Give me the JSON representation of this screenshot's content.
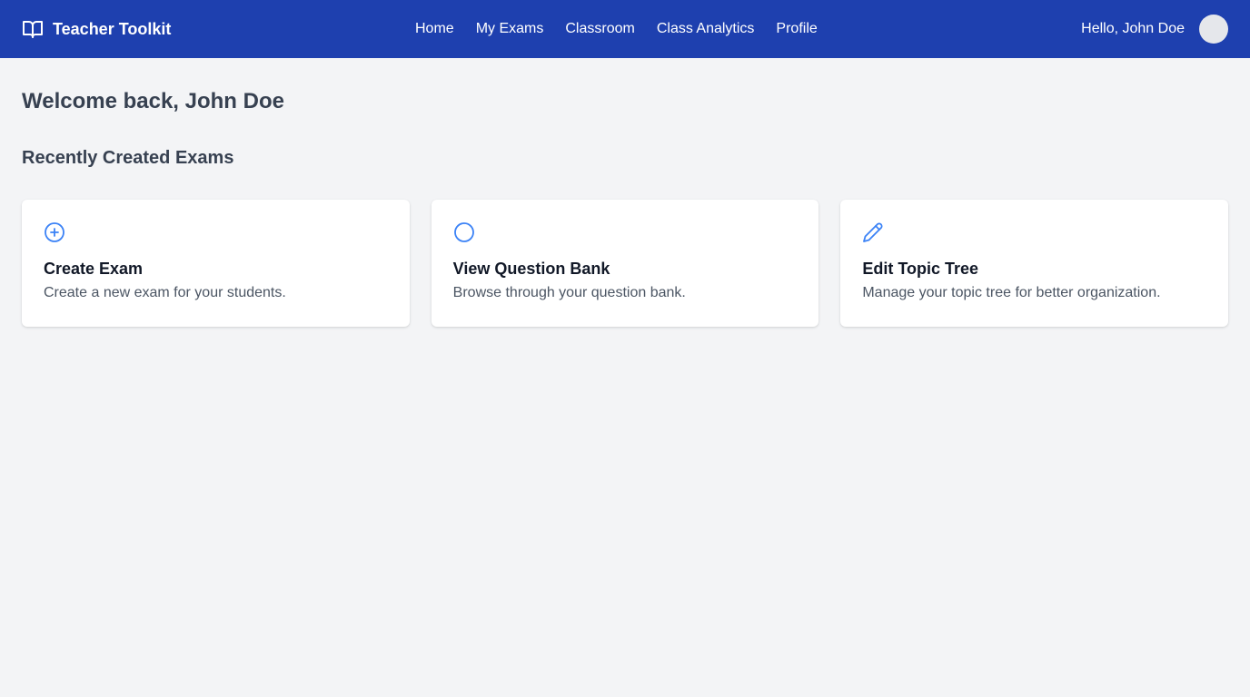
{
  "header": {
    "brand": "Teacher Toolkit",
    "brand_icon": "book-open-icon",
    "nav": [
      {
        "label": "Home"
      },
      {
        "label": "My Exams"
      },
      {
        "label": "Classroom"
      },
      {
        "label": "Class Analytics"
      },
      {
        "label": "Profile"
      }
    ],
    "greeting": "Hello, John Doe"
  },
  "main": {
    "title": "Welcome back, John Doe",
    "section_title": "Recently Created Exams",
    "cards": [
      {
        "icon": "plus-circle-icon",
        "title": "Create Exam",
        "description": "Create a new exam for your students."
      },
      {
        "icon": "circle-icon",
        "title": "View Question Bank",
        "description": "Browse through your question bank."
      },
      {
        "icon": "pencil-icon",
        "title": "Edit Topic Tree",
        "description": "Manage your topic tree for better organization."
      }
    ]
  },
  "colors": {
    "header_bg": "#1e40af",
    "page_bg": "#f3f4f6",
    "icon_accent": "#3b82f6"
  }
}
